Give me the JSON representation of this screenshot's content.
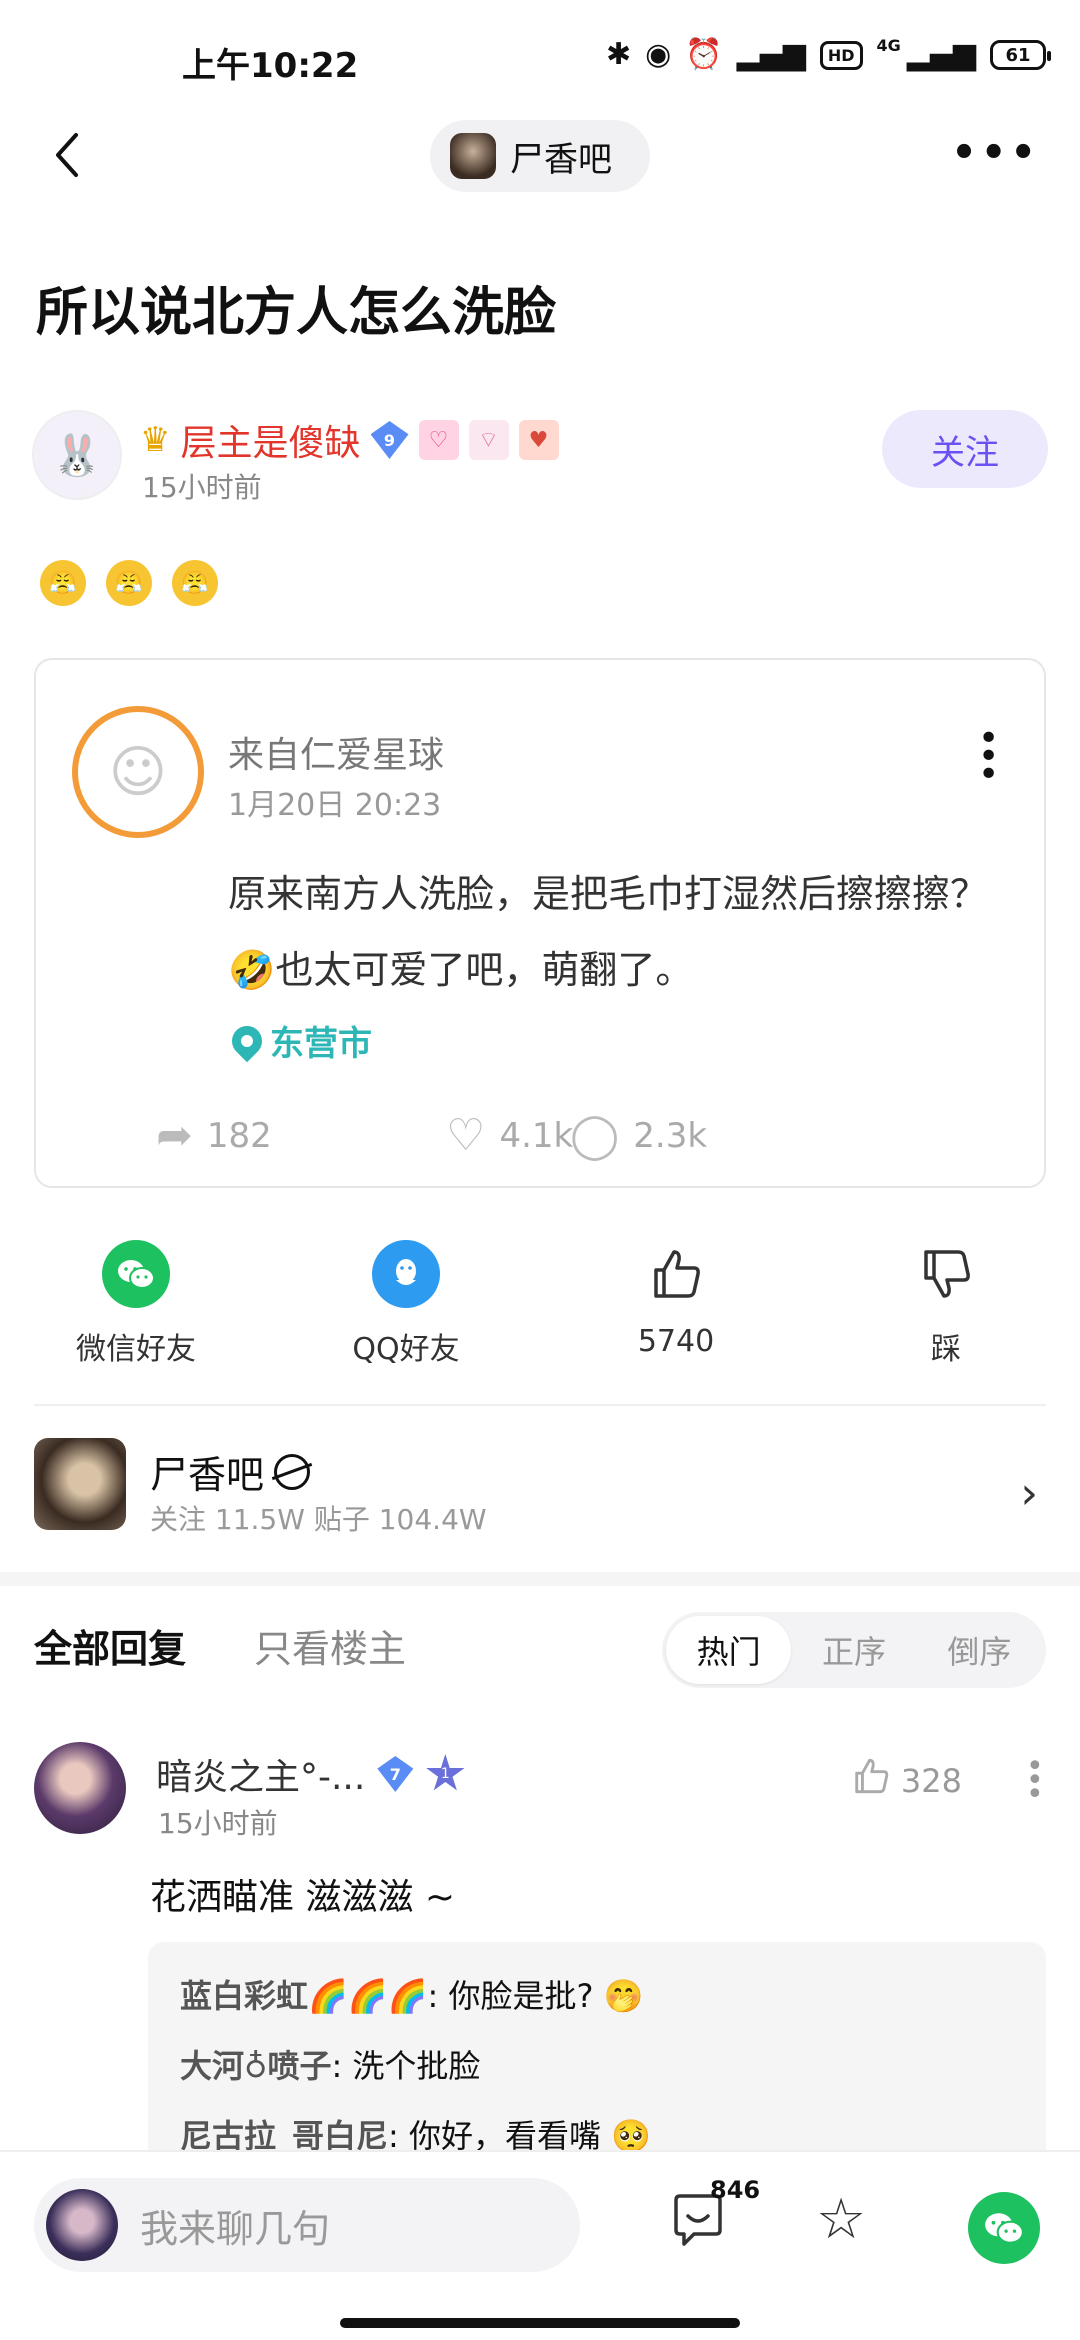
{
  "status_bar": {
    "time": "上午10:22",
    "hd": "HD",
    "network": "4G",
    "battery": "61"
  },
  "nav": {
    "forum_name": "尸香吧"
  },
  "post": {
    "title": "所以说北方人怎么洗脸",
    "author": {
      "name": "层主是傻缺",
      "level": "9",
      "time": "15小时前",
      "follow_label": "关注"
    },
    "emojis": [
      "😤",
      "😤",
      "😤"
    ]
  },
  "screenshot": {
    "user": "来自仁爱星球",
    "date": "1月20日 20:23",
    "text": "原来南方人洗脸，是把毛巾打湿然后擦擦擦？🤣也太可爱了吧，萌翻了。",
    "location": "东营市",
    "shares": "182",
    "likes": "4.1k",
    "comments": "2.3k"
  },
  "share": {
    "wechat": "微信好友",
    "qq": "QQ好友",
    "like_count": "5740",
    "dislike": "踩"
  },
  "forum": {
    "name": "尸香吧",
    "stats": "关注 11.5W   贴子 104.4W"
  },
  "replies": {
    "tab_all": "全部回复",
    "tab_op": "只看楼主",
    "sort": [
      "热门",
      "正序",
      "倒序"
    ]
  },
  "comment": {
    "name": "暗炎之主°-...",
    "level": "7",
    "star_level": "1",
    "time": "15小时前",
    "likes": "328",
    "text": "花洒瞄准 滋滋滋 ~",
    "subs": [
      {
        "user": "蓝白彩虹🌈🌈🌈",
        "text": ": 你脸是批? 🤭"
      },
      {
        "user": "大河♁喷子",
        "text": ": 洗个批脸"
      },
      {
        "user": "尼古拉_哥白尼",
        "text": ": 你好，看看嘴 🥺"
      }
    ]
  },
  "bottom": {
    "placeholder": "我来聊几句",
    "comment_count": "846"
  },
  "colors": {
    "accent": "#6a52f2",
    "author_red": "#e2352b",
    "location": "#2cb6b6",
    "wechat": "#1ec15f",
    "qq": "#2d9cf0"
  }
}
